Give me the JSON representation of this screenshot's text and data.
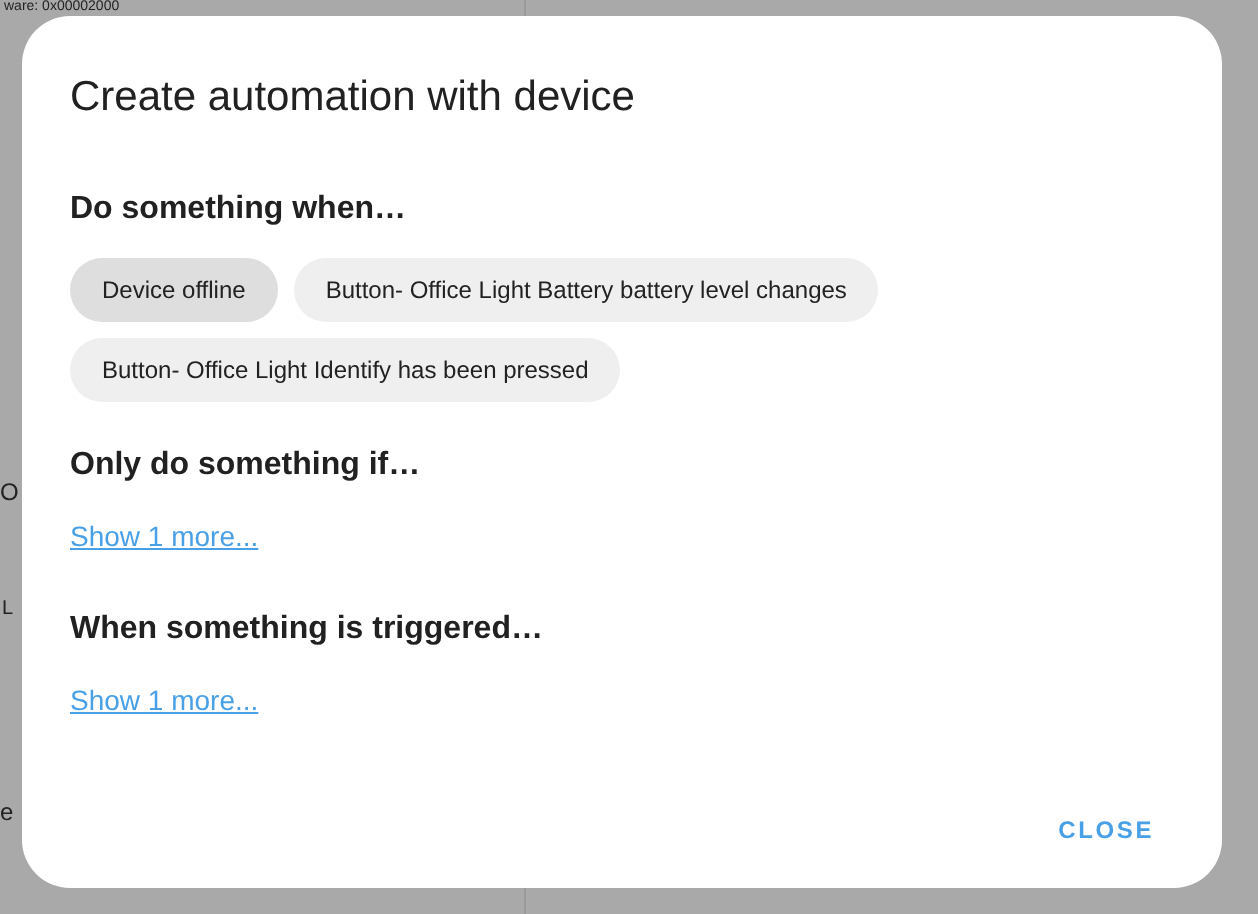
{
  "background": {
    "texts": [
      {
        "kind": "small",
        "text": "ware: 0x00002000"
      },
      {
        "kind": "big",
        "text": "O"
      },
      {
        "kind": "small",
        "text": "L"
      },
      {
        "kind": "big",
        "text": "e"
      }
    ]
  },
  "dialog": {
    "title": "Create automation with device",
    "sections": [
      {
        "heading": "Do something when…",
        "chips": [
          {
            "label": "Device offline",
            "selected": true
          },
          {
            "label": "Button- Office Light Battery battery level changes",
            "selected": false
          },
          {
            "label": "Button- Office Light Identify has been pressed",
            "selected": false
          }
        ]
      },
      {
        "heading": "Only do something if…",
        "link": "Show 1 more..."
      },
      {
        "heading": "When something is triggered…",
        "link": "Show 1 more..."
      }
    ],
    "button": "CLOSE"
  }
}
